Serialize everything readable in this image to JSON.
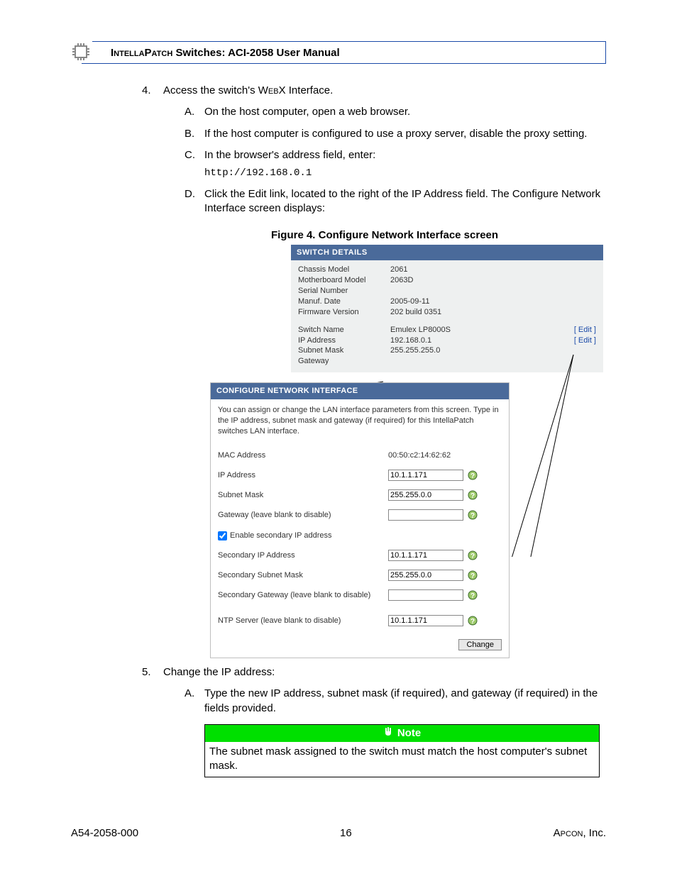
{
  "header": {
    "product_sc": "IntellaPatch",
    "rest": " Switches: ACI-2058 User Manual"
  },
  "step4": {
    "num": "4.",
    "intro_pre": "Access the switch's ",
    "intro_sc": "Web",
    "intro_post": "X Interface.",
    "a": {
      "let": "A.",
      "text": "On the host computer, open a web browser."
    },
    "b": {
      "let": "B.",
      "text": "If the host computer is configured to use a proxy server, disable the proxy setting."
    },
    "c": {
      "let": "C.",
      "text": "In the browser's address field, enter:"
    },
    "c_code": "http://192.168.0.1",
    "d": {
      "let": "D.",
      "text": "Click the Edit link, located to the right of the IP Address field. The Configure Network Interface screen displays:"
    }
  },
  "figure_caption": "Figure 4. Configure Network Interface screen",
  "sd": {
    "title": "SWITCH DETAILS",
    "rows1": [
      {
        "lab": "Chassis Model",
        "val": "2061"
      },
      {
        "lab": "Motherboard Model",
        "val": "2063D"
      },
      {
        "lab": "Serial Number",
        "val": ""
      },
      {
        "lab": "Manuf. Date",
        "val": "2005-09-11"
      },
      {
        "lab": "Firmware Version",
        "val": "202 build 0351"
      }
    ],
    "rows2": [
      {
        "lab": "Switch Name",
        "val": "Emulex LP8000S",
        "edit": "[ Edit ]"
      },
      {
        "lab": "IP Address",
        "val": "192.168.0.1",
        "edit": "[ Edit ]"
      },
      {
        "lab": "Subnet Mask",
        "val": "255.255.255.0",
        "edit": ""
      },
      {
        "lab": "Gateway",
        "val": "",
        "edit": ""
      }
    ]
  },
  "cni": {
    "title": "CONFIGURE NETWORK INTERFACE",
    "intro": "You can assign or change the LAN interface parameters from this screen. Type in the IP address, subnet mask and gateway (if required) for this IntellaPatch switches LAN interface.",
    "mac_label": "MAC Address",
    "mac_value": "00:50:c2:14:62:62",
    "ip_label": "IP Address",
    "ip_value": "10.1.1.171",
    "subnet_label": "Subnet Mask",
    "subnet_value": "255.255.0.0",
    "gateway_label": "Gateway (leave blank to disable)",
    "gateway_value": "",
    "enable_secondary_label": "Enable secondary IP address",
    "sec_ip_label": "Secondary IP Address",
    "sec_ip_value": "10.1.1.171",
    "sec_subnet_label": "Secondary  Subnet Mask",
    "sec_subnet_value": "255.255.0.0",
    "sec_gateway_label": "Secondary Gateway (leave blank to disable)",
    "sec_gateway_value": "",
    "ntp_label": "NTP Server (leave blank to disable)",
    "ntp_value": "10.1.1.171",
    "change_btn": "Change"
  },
  "step5": {
    "num": "5.",
    "text": "Change the IP address:",
    "a": {
      "let": "A.",
      "text": "Type the new IP address, subnet mask (if required), and gateway (if required) in the fields provided."
    }
  },
  "note": {
    "title": "Note",
    "body": "The subnet mask assigned to the switch must match the host computer's subnet mask."
  },
  "footer": {
    "left": "A54-2058-000",
    "center": "16",
    "right_sc": "Apcon",
    "right_post": ", Inc."
  }
}
